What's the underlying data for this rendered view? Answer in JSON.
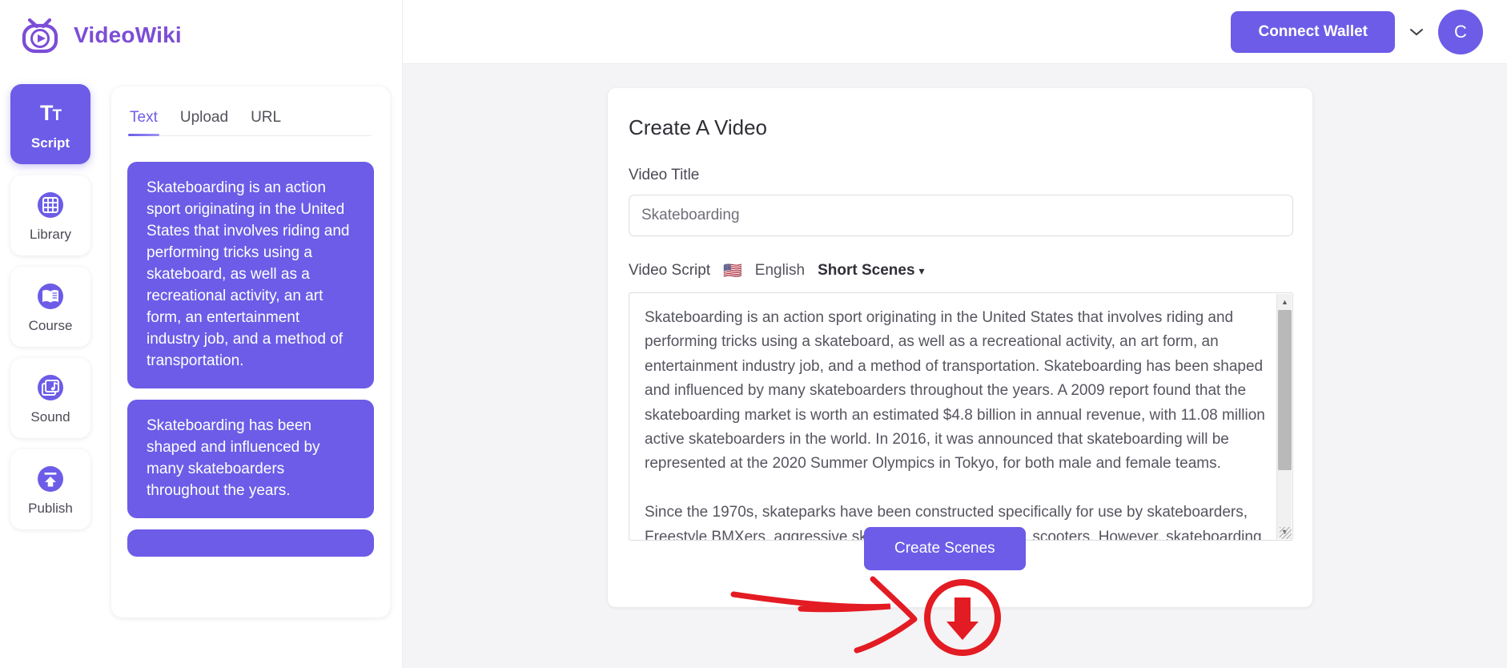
{
  "brand": {
    "name": "VideoWiki",
    "logo_icon": "videowiki-tv-play-logo",
    "color": "#7c4dd6"
  },
  "theme": {
    "accent": "#6c5ce7",
    "stage_bg": "#f4f4f6",
    "annotation": "#e31b23"
  },
  "topbar": {
    "connect_wallet_label": "Connect Wallet",
    "chevron_icon": "chevron-down-icon",
    "avatar_initial": "C"
  },
  "sidebar": {
    "items": [
      {
        "label": "Script",
        "icon": "text-format-icon",
        "active": true
      },
      {
        "label": "Library",
        "icon": "grid-icon",
        "active": false
      },
      {
        "label": "Course",
        "icon": "open-book-icon",
        "active": false
      },
      {
        "label": "Sound",
        "icon": "music-note-icon",
        "active": false
      },
      {
        "label": "Publish",
        "icon": "upload-arrow-icon",
        "active": false
      }
    ]
  },
  "script_panel": {
    "tabs": [
      {
        "label": "Text",
        "active": true
      },
      {
        "label": "Upload",
        "active": false
      },
      {
        "label": "URL",
        "active": false
      }
    ],
    "blocks": [
      "Skateboarding is an action sport originating in the United States that involves riding and performing tricks using a skateboard, as well as a recreational activity, an art form, an entertainment industry job, and a method of transportation.",
      "Skateboarding has been shaped and influenced by many skateboarders throughout the years."
    ]
  },
  "create_card": {
    "title": "Create A Video",
    "video_title_label": "Video Title",
    "video_title_value": "Skateboarding",
    "video_title_placeholder": "Skateboarding",
    "video_script_label": "Video Script",
    "flag_icon": "us-flag-icon",
    "flag_glyph": "🇺🇸",
    "language": "English",
    "scene_length": "Short Scenes",
    "scene_chevron_icon": "chevron-down-icon",
    "script_value": "Skateboarding is an action sport originating in the United States that involves riding and performing tricks using a skateboard, as well as a recreational activity, an art form, an entertainment industry job, and a method of transportation. Skateboarding has been shaped and influenced by many skateboarders throughout the years. A 2009 report found that the skateboarding market is worth an estimated $4.8 billion in annual revenue, with 11.08 million active skateboarders in the world. In 2016, it was announced that skateboarding will be represented at the 2020 Summer Olympics in Tokyo, for both male and female teams.\n\nSince the 1970s, skateparks have been constructed specifically for use by skateboarders, Freestyle BMXers, aggressive skaters, and very recently, scooters. However, skateboarding",
    "create_scenes_label": "Create Scenes"
  },
  "annotation": {
    "arrow_icon": "hand-drawn-arrow",
    "target_icon": "circled-down-arrow-icon"
  }
}
